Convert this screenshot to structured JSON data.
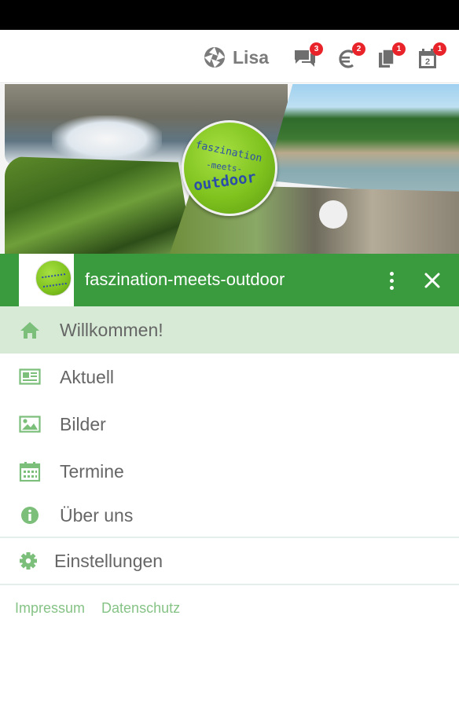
{
  "topbar": {
    "user_name": "Lisa",
    "icons": [
      {
        "name": "chat-icon",
        "badge": "3"
      },
      {
        "name": "euro-icon",
        "badge": "2"
      },
      {
        "name": "documents-icon",
        "badge": "1"
      },
      {
        "name": "calendar-icon",
        "badge": "1",
        "day": "2"
      }
    ]
  },
  "banner": {
    "logo_line1": "faszination",
    "logo_line2": "-meets-",
    "logo_line3": "outdoor"
  },
  "drawer": {
    "title": "faszination-meets-outdoor"
  },
  "menu": {
    "items": [
      {
        "label": "Willkommen!",
        "icon": "home-icon",
        "active": true
      },
      {
        "label": "Aktuell",
        "icon": "newspaper-icon"
      },
      {
        "label": "Bilder",
        "icon": "image-icon"
      },
      {
        "label": "Termine",
        "icon": "calendar-icon"
      },
      {
        "label": "Über uns",
        "icon": "info-icon"
      }
    ],
    "settings_label": "Einstellungen"
  },
  "footer": {
    "impressum": "Impressum",
    "datenschutz": "Datenschutz"
  },
  "colors": {
    "primary": "#3a9a3e",
    "active_bg": "#d6ead6",
    "icon_green": "#7bbf7b",
    "badge_red": "#e8232a",
    "link": "#86c386"
  }
}
